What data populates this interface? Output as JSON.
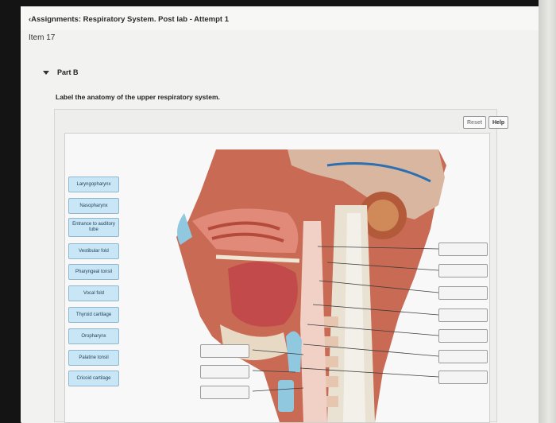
{
  "header": {
    "breadcrumb": "‹Assignments: Respiratory System. Post lab - Attempt 1",
    "item_title": "Item 17"
  },
  "part": {
    "label": "Part B"
  },
  "instruction": "Label the anatomy of the upper respiratory system.",
  "controls": {
    "reset_label": "Reset",
    "help_label": "Help"
  },
  "labels": [
    "Laryngopharynx",
    "Nasopharynx",
    "Entrance to auditory tube",
    "Vestibular fold",
    "Pharyngeal tonsil",
    "Vocal fold",
    "Thyroid cartilage",
    "Oropharynx",
    "Palatine tonsil",
    "Cricoid cartilage"
  ],
  "drop_targets_count": 10,
  "colors": {
    "chip_bg": "#c9e6f6",
    "chip_border": "#8fb8cf",
    "tissue": "#c96a55",
    "brain": "#d9b6a0",
    "cartilage": "#8fc8df"
  }
}
